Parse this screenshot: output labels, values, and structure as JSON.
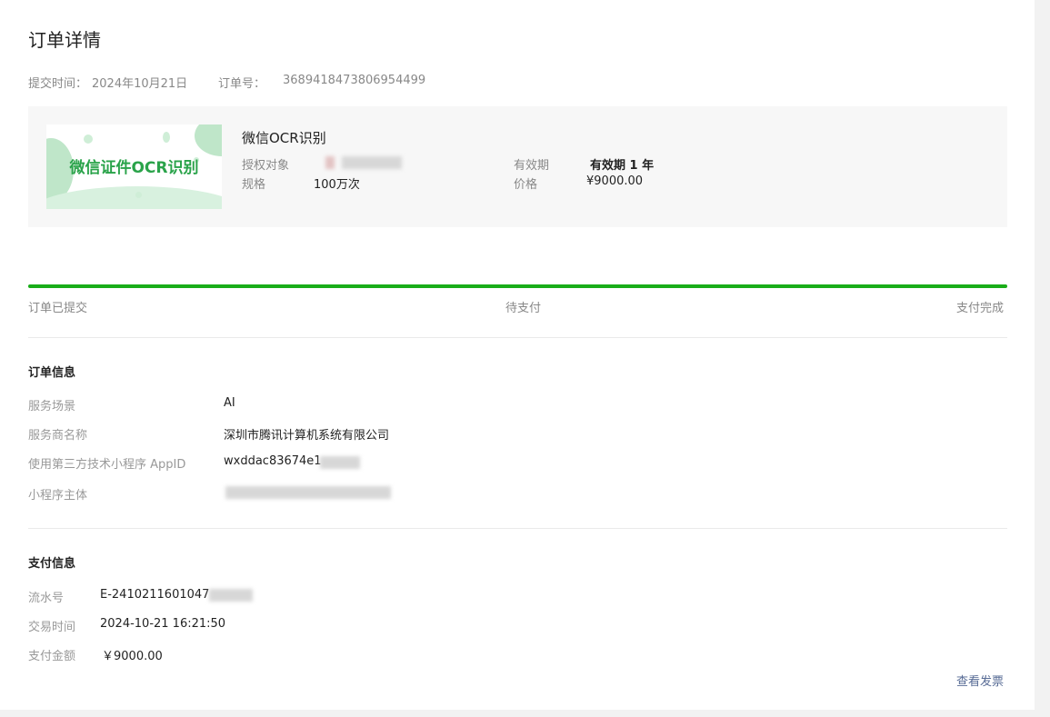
{
  "page": {
    "title": "订单详情"
  },
  "meta": {
    "submit_label": "提交时间：",
    "submit_date": "2024年10月21日",
    "order_no_label": "订单号：",
    "order_no": "3689418473806954499"
  },
  "product": {
    "thumb_text": "微信证件OCR识别",
    "name": "微信OCR识别",
    "auth_label": "授权对象",
    "auth_value": "",
    "spec_label": "规格",
    "spec_value": "100万次",
    "validity_label": "有效期",
    "validity_value": "有效期 1 年",
    "price_label": "价格",
    "price_value": "¥9000.00"
  },
  "progress": {
    "value_percent": 100,
    "steps": [
      "订单已提交",
      "待支付",
      "支付完成"
    ]
  },
  "order_info": {
    "heading": "订单信息",
    "rows": [
      {
        "label": "服务场景",
        "value": "AI"
      },
      {
        "label": "服务商名称",
        "value": "深圳市腾讯计算机系统有限公司"
      },
      {
        "label": "使用第三方技术小程序 AppID",
        "value": "wxddac83674e1"
      },
      {
        "label": "小程序主体",
        "value": ""
      }
    ]
  },
  "payment_info": {
    "heading": "支付信息",
    "rows": [
      {
        "label": "流水号",
        "value": "E-2410211601047"
      },
      {
        "label": "交易时间",
        "value": "2024-10-21 16:21:50"
      },
      {
        "label": "支付金额",
        "value": "￥9000.00"
      }
    ]
  },
  "actions": {
    "view_invoice": "查看发票"
  },
  "colors": {
    "accent_green": "#1aad19",
    "link_blue": "#576b95"
  }
}
